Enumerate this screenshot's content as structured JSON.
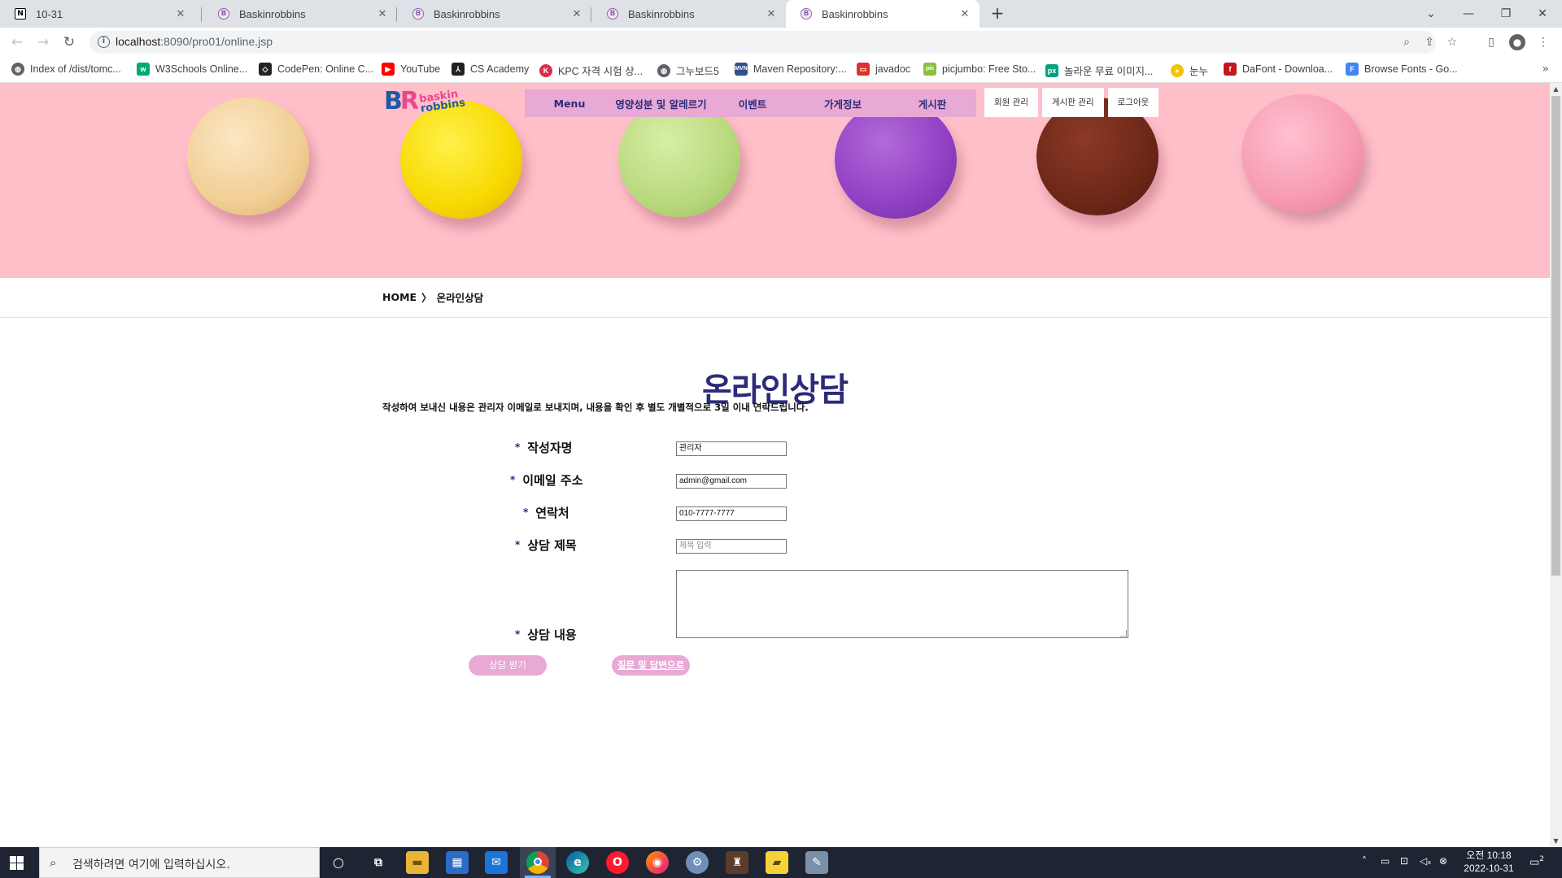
{
  "browser": {
    "tabs": [
      {
        "title": "10-31",
        "icon": "notion-icon",
        "active": false
      },
      {
        "title": "Baskinrobbins",
        "icon": "baskinrobbins-favicon",
        "active": false
      },
      {
        "title": "Baskinrobbins",
        "icon": "baskinrobbins-favicon",
        "active": false
      },
      {
        "title": "Baskinrobbins",
        "icon": "baskinrobbins-favicon",
        "active": false
      },
      {
        "title": "Baskinrobbins",
        "icon": "baskinrobbins-favicon",
        "active": true
      }
    ],
    "url_host": "localhost",
    "url_path": ":8090/pro01/online.jsp",
    "bookmarks": [
      {
        "label": "Index of /dist/tomc...",
        "icon": "globe-icon",
        "color": "#5f6368"
      },
      {
        "label": "W3Schools Online...",
        "icon": "w3schools-icon",
        "color": "#04aa6d"
      },
      {
        "label": "CodePen: Online C...",
        "icon": "codepen-icon",
        "color": "#222222"
      },
      {
        "label": "YouTube",
        "icon": "youtube-icon",
        "color": "#ff0000"
      },
      {
        "label": "CS Academy",
        "icon": "cs-academy-icon",
        "color": "#222222"
      },
      {
        "label": "KPC 자격 시험 상...",
        "icon": "kpc-icon",
        "color": "#d6304a"
      },
      {
        "label": "그누보드5",
        "icon": "globe-icon",
        "color": "#5f6368"
      },
      {
        "label": "Maven Repository:...",
        "icon": "maven-icon",
        "color": "#2f4f8f"
      },
      {
        "label": "javadoc",
        "icon": "javadoc-icon",
        "color": "#e0302b"
      },
      {
        "label": "picjumbo: Free Sto...",
        "icon": "picjumbo-icon",
        "color": "#8bbf3f"
      },
      {
        "label": "놀라운 무료 이미지...",
        "icon": "pexels-icon",
        "color": "#05a081"
      },
      {
        "label": "눈누",
        "icon": "noonnu-icon",
        "color": "#f5c400"
      },
      {
        "label": "DaFont - Downloa...",
        "icon": "dafont-icon",
        "color": "#c4161c"
      },
      {
        "label": "Browse Fonts - Go...",
        "icon": "google-fonts-icon",
        "color": "#4285f4"
      }
    ]
  },
  "site": {
    "logo_mark": "BR",
    "logo_line1": "baskin",
    "logo_line2": "robbins",
    "nav": [
      "Menu",
      "영양성분 및 알레르기",
      "이벤트",
      "가게정보",
      "게시판"
    ],
    "admin_buttons": [
      "회원 관리",
      "게시판 관리",
      "로그아웃"
    ],
    "breadcrumb": {
      "home": "HOME",
      "separator": "〉",
      "current": "온라인상담"
    },
    "title": "온라인상담",
    "description": "작성하여 보내신 내용은 관리자 이메일로 보내지며, 내용을 확인 후 별도 개별적으로 3일 이내 연락드립니다.",
    "form": {
      "required_mark": "*",
      "author_label": "작성자명",
      "author_value": "관리자",
      "email_label": "이메일 주소",
      "email_value": "admin@gmail.com",
      "phone_label": "연락처",
      "phone_value": "010-7777-7777",
      "subject_label": "상담 제목",
      "subject_placeholder": "제목 입력",
      "content_label": "상담 내용",
      "content_value": "",
      "submit_button": "상담 받기",
      "faq_button": "질문 및 답변으로"
    },
    "colors": {
      "hero_bg": "#ffbfc9",
      "nav_bg": "#e8a9d5",
      "accent": "#2b2b7a",
      "button_bg": "#e8a9d5"
    }
  },
  "taskbar": {
    "search_placeholder": "검색하려면 여기에 입력하십시오.",
    "time": "오전 10:18",
    "date": "2022-10-31",
    "notification_count": "2"
  }
}
